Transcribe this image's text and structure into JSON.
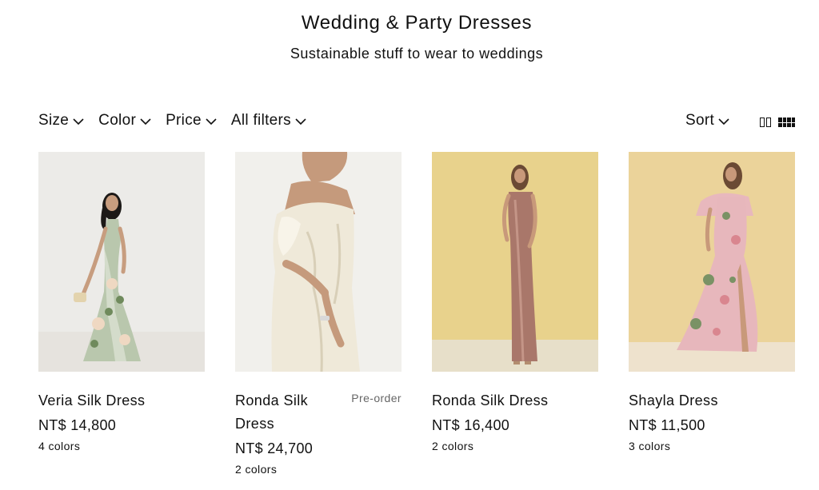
{
  "header": {
    "title": "Wedding & Party Dresses",
    "subtitle": "Sustainable stuff to wear to weddings"
  },
  "filters": [
    {
      "label": "Size",
      "icon": "chevron-down-icon"
    },
    {
      "label": "Color",
      "icon": "chevron-down-icon"
    },
    {
      "label": "Price",
      "icon": "chevron-down-icon"
    },
    {
      "label": "All filters",
      "icon": "chevron-down-icon"
    }
  ],
  "sort": {
    "label": "Sort",
    "icon": "chevron-down-icon"
  },
  "view_toggles": [
    {
      "icon": "grid-2-column-icon"
    },
    {
      "icon": "grid-4-column-icon",
      "active": true
    }
  ],
  "products": [
    {
      "name": "Veria Silk Dress",
      "badge": "",
      "price": "NT$ 14,800",
      "colors": "4 colors",
      "image": "model in sage floral silk halter gown",
      "bg": "#ecebe8"
    },
    {
      "name": "Ronda Silk Dress",
      "badge": "Pre-order",
      "price": "NT$ 24,700",
      "colors": "2 colors",
      "image": "model in ivory silk cowl slip dress",
      "bg": "#f1f0ec"
    },
    {
      "name": "Ronda Silk Dress",
      "badge": "",
      "price": "NT$ 16,400",
      "colors": "2 colors",
      "image": "model in mauve silk slip gown",
      "bg": "#e8d28c"
    },
    {
      "name": "Shayla Dress",
      "badge": "",
      "price": "NT$ 11,500",
      "colors": "3 colors",
      "image": "model in pink floral flutter-sleeve gown",
      "bg": "#ebd39a"
    }
  ],
  "colors": {
    "text": "#111111",
    "badge": "#666666",
    "background": "#ffffff"
  }
}
